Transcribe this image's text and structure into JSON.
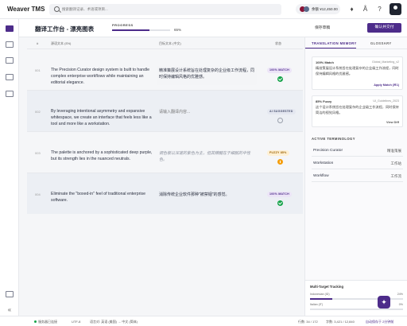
{
  "app": {
    "name": "Weaver TMS"
  },
  "search": {
    "placeholder": "搜索翻译记录、术语或项目..."
  },
  "balance": {
    "text": "余额 ¥12,450.00"
  },
  "page": {
    "title": "翻译工作台 - 漂亮图表",
    "progress_label": "PROGRESS",
    "progress_value": "65%",
    "progress_fraction": 0.65,
    "save_draft": "保存草稿",
    "confirm_submit": "确认并交付"
  },
  "table": {
    "headers": {
      "num": "#",
      "source": "源语文本 (EN)",
      "target": "目标文本 (中文)",
      "status": "状态"
    },
    "rows": [
      {
        "num": "001",
        "source": "The Precision Curator design system is built to handle complex enterprise workflows while maintaining an editorial elegance.",
        "target": "精准策展设计系统旨在处理复杂的企业级工作流程，同时保持编辑风格的优雅感。",
        "badge": "100% MATCH",
        "badge_type": "exact",
        "status": "ok"
      },
      {
        "num": "002",
        "source": "By leveraging intentional asymmetry and expansive whitespace, we create an interface that feels less like a tool and more like a workstation.",
        "target": "请输入翻译内容...",
        "badge": "AI SUGGESTED",
        "badge_type": "ai",
        "status": "open"
      },
      {
        "num": "003",
        "source": "The palette is anchored by a sophisticated deep purple, but its strength lies in the nuanced neutrals.",
        "target": "调色板以深邃的紫色为主，但其精髓在于细腻的中性色。",
        "badge": "FUZZY 85%",
        "badge_type": "fuzzy",
        "status": "warn"
      },
      {
        "num": "004",
        "source": "Eliminate the \"boxed-in\" feel of traditional enterprise software.",
        "target": "消除传统企业软件那种\"被禁锢\"的感觉。",
        "badge": "100% MATCH",
        "badge_type": "exact",
        "status": "ok"
      }
    ]
  },
  "panel": {
    "tabs": [
      "TRANSLATION MEMORY",
      "GLOSSARY"
    ],
    "cards": [
      {
        "score": "100% Match",
        "meta": "Global_Marketing_v2",
        "text": "精准策展设计系统旨在处理复杂的企业级工作流程，同时保持编辑风格的优雅感。",
        "action": "Apply Match (⌘1)"
      },
      {
        "score": "85% Fuzzy",
        "meta": "UI_Guidelines_2023",
        "text": "这个设计系统旨在处理复杂的企业级工作流程，同时保持简洁的视觉风格。",
        "action": "View Diff"
      }
    ],
    "terminology_title": "ACTIVE TERMINOLOGY",
    "terms": [
      {
        "source": "Precision Curator",
        "target": "精准策展"
      },
      {
        "source": "Workstation",
        "target": "工作站"
      },
      {
        "source": "Workflow",
        "target": "工作流"
      }
    ],
    "tracking": {
      "title": "Multi-Target Tracking",
      "items": [
        {
          "label": "Indonesian (ID)",
          "value": "24%",
          "fraction": 0.24
        },
        {
          "label": "Italian (IT)",
          "value": "0%",
          "fraction": 0.0
        }
      ]
    }
  },
  "statusbar": {
    "connection": "服务器已连接",
    "encoding": "UTF-8",
    "lang_pair": "语言对: 英语 (美国) → 中文 (简体)",
    "position": "行数: 34 / 172",
    "wordcount": "字数: 3,421 / 12,840",
    "autosave": "自动保存于 2分钟前"
  },
  "colors": {
    "accent": "#4d2c8a",
    "success": "#16a34a",
    "warning": "#f59e0b"
  }
}
